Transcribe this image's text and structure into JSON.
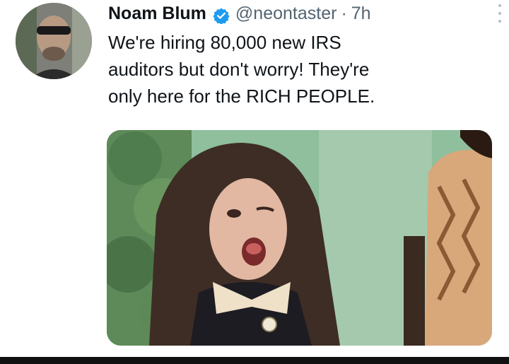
{
  "tweet": {
    "author_name": "Noam Blum",
    "handle": "@neontaster",
    "separator": "·",
    "time": "7h",
    "text": "We're hiring 80,000 new IRS\nauditors but don't worry! They're\nonly here for the RICH PEOPLE.",
    "verified_icon": "verified-badge-icon",
    "more_icon": "more-options-icon"
  },
  "colors": {
    "text_primary": "#0f1419",
    "text_secondary": "#536471",
    "verified_blue": "#1d9bf0"
  }
}
